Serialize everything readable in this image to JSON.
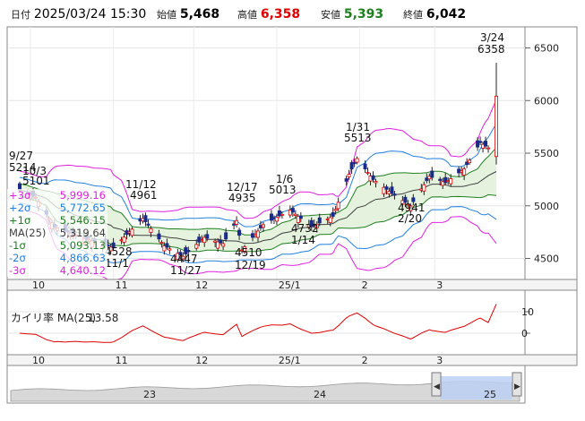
{
  "header": {
    "label_datetime": "日付",
    "datetime": "2025/03/24 15:30",
    "label_open": "始値",
    "open": "5,468",
    "label_high": "高値",
    "high": "6,358",
    "label_low": "安値",
    "low": "5,393",
    "label_close": "終値",
    "close": "6,042"
  },
  "legend": [
    {
      "name": "+3σ",
      "value": "5,999.16",
      "color": "#e020e0"
    },
    {
      "name": "+2σ",
      "value": "5,772.65",
      "color": "#2080e0"
    },
    {
      "name": "+1σ",
      "value": "5,546.15",
      "color": "#208020"
    },
    {
      "name": "MA(25)",
      "value": "5,319.64",
      "color": "#404040"
    },
    {
      "name": "-1σ",
      "value": "5,093.13",
      "color": "#208020"
    },
    {
      "name": "-2σ",
      "value": "4,866.63",
      "color": "#2080e0"
    },
    {
      "name": "-3σ",
      "value": "4,640.12",
      "color": "#e020e0"
    }
  ],
  "price_axis": [
    "6500",
    "6000",
    "5500",
    "5000",
    "4500"
  ],
  "month_axis": [
    "10",
    "11",
    "12",
    "25/1",
    "2",
    "3"
  ],
  "annotations": [
    {
      "date": "9/27",
      "value": "5214"
    },
    {
      "date": "10/3",
      "value": "5101"
    },
    {
      "date": "11/12",
      "value": "4961"
    },
    {
      "date": "11/1",
      "value": "4528"
    },
    {
      "date": "11/27",
      "value": "4447"
    },
    {
      "date": "12/17",
      "value": "4935"
    },
    {
      "date": "12/19",
      "value": "4510"
    },
    {
      "date": "1/6",
      "value": "5013"
    },
    {
      "date": "1/14",
      "value": "4732"
    },
    {
      "date": "1/31",
      "value": "5513"
    },
    {
      "date": "2/20",
      "value": "4941"
    },
    {
      "date": "3/24",
      "value": "6358"
    }
  ],
  "deviation": {
    "label": "カイリ率 MA(25)",
    "value": "13.58",
    "axis": [
      "10",
      "0"
    ],
    "color": "#e00000"
  },
  "navigator": {
    "years": [
      "23",
      "24",
      "25"
    ],
    "arrow_left": "◀",
    "arrow_right": "▶"
  },
  "colors": {
    "up_candle": "#ffffff",
    "down_candle": "#1a2a8a",
    "high_value": "#e00000",
    "low_value": "#208020",
    "ma": "#404040"
  },
  "chart_data": {
    "type": "candlestick",
    "x_range": [
      "2024/09/27",
      "2025/03/24"
    ],
    "ylim": [
      4300,
      6700
    ],
    "y_ticks": [
      4500,
      5000,
      5500,
      6000,
      6500
    ],
    "bands": [
      "+3σ",
      "+2σ",
      "+1σ",
      "MA(25)",
      "-1σ",
      "-2σ",
      "-3σ"
    ],
    "labeled_points": [
      {
        "date": "2024/09/27",
        "value": 5214,
        "kind": "high"
      },
      {
        "date": "2024/10/03",
        "value": 5101,
        "kind": "high"
      },
      {
        "date": "2024/11/01",
        "value": 4528,
        "kind": "low"
      },
      {
        "date": "2024/11/12",
        "value": 4961,
        "kind": "high"
      },
      {
        "date": "2024/11/27",
        "value": 4447,
        "kind": "low"
      },
      {
        "date": "2024/12/17",
        "value": 4935,
        "kind": "high"
      },
      {
        "date": "2024/12/19",
        "value": 4510,
        "kind": "low"
      },
      {
        "date": "2025/01/06",
        "value": 5013,
        "kind": "high"
      },
      {
        "date": "2025/01/14",
        "value": 4732,
        "kind": "low"
      },
      {
        "date": "2025/01/31",
        "value": 5513,
        "kind": "high"
      },
      {
        "date": "2025/02/20",
        "value": 4941,
        "kind": "low"
      },
      {
        "date": "2025/03/24",
        "value": 6358,
        "kind": "high"
      }
    ],
    "last_bar": {
      "date": "2025/03/24",
      "open": 5468,
      "high": 6358,
      "low": 5393,
      "close": 6042
    },
    "deviation_last": 13.58,
    "deviation_ylim": [
      -10,
      20
    ]
  }
}
